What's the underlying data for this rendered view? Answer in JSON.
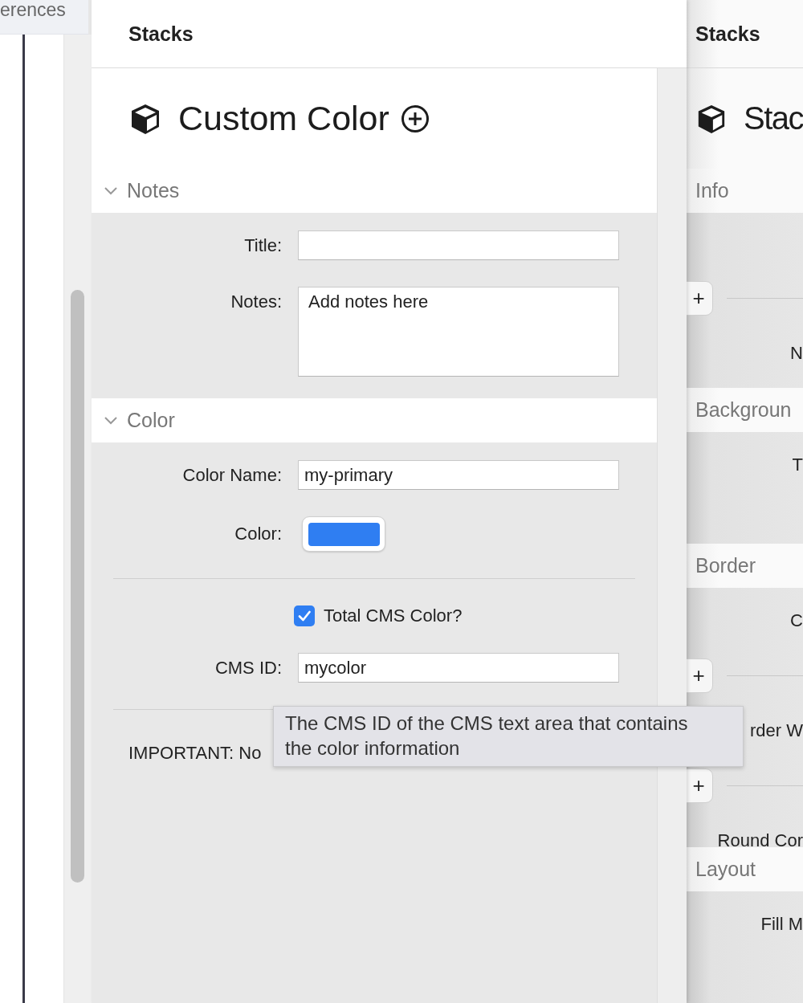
{
  "left_pane": {
    "title_fragment": "erences"
  },
  "inspector": {
    "header": "Stacks",
    "title": "Custom Color",
    "sections": [
      {
        "title": "Notes",
        "expanded": true,
        "fields": [
          {
            "kind": "text",
            "label": "Title:"
          },
          {
            "kind": "textarea",
            "label": "Notes:",
            "placeholder": "Add notes here"
          }
        ]
      },
      {
        "title": "Color",
        "expanded": true,
        "fields": [
          {
            "kind": "text",
            "label": "Color Name:",
            "value": "my-primary"
          },
          {
            "kind": "color",
            "label": "Color:",
            "color": "#2f7ef2"
          },
          {
            "kind": "divider"
          },
          {
            "kind": "checkbox",
            "label": "Total CMS Color?",
            "checked": true
          },
          {
            "kind": "text",
            "label": "CMS ID:",
            "value": "mycolor"
          },
          {
            "kind": "divider"
          },
          {
            "kind": "note",
            "text": "IMPORTANT: No"
          }
        ]
      }
    ]
  },
  "tooltip": {
    "text": "The CMS ID of the CMS text area that contains the color information"
  },
  "side_panel": {
    "header": "Stacks",
    "title": "Stac",
    "groups": [
      {
        "title": "Info",
        "items": [
          {
            "kind": "add",
            "text": "+"
          },
          {
            "kind": "label",
            "text": "N"
          }
        ]
      },
      {
        "title": "Backgroun",
        "items": [
          {
            "kind": "label",
            "text": "T"
          }
        ]
      },
      {
        "title": "Border",
        "items": [
          {
            "kind": "label",
            "text": "C"
          },
          {
            "kind": "add",
            "text": "+"
          },
          {
            "kind": "label",
            "text": "rder W"
          },
          {
            "kind": "add",
            "text": "+"
          },
          {
            "kind": "label",
            "text": "Round Cor"
          }
        ]
      },
      {
        "title": "Layout",
        "items": [
          {
            "kind": "label",
            "text": "Fill M"
          }
        ]
      }
    ]
  }
}
